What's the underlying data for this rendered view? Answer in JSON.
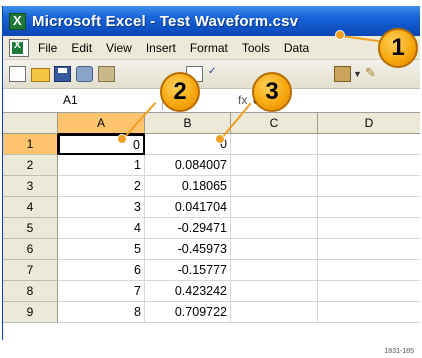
{
  "window": {
    "title": "Microsoft Excel - Test Waveform.csv"
  },
  "menu": {
    "items": [
      "File",
      "Edit",
      "View",
      "Insert",
      "Format",
      "Tools",
      "Data"
    ]
  },
  "formula_bar": {
    "name_box": "A1",
    "fx": "fx",
    "value": "0"
  },
  "sheet": {
    "columns": [
      "A",
      "B",
      "C",
      "D"
    ],
    "rows": [
      {
        "num": "1",
        "a": "0",
        "b": "0"
      },
      {
        "num": "2",
        "a": "1",
        "b": "0.084007"
      },
      {
        "num": "3",
        "a": "2",
        "b": "0.18065"
      },
      {
        "num": "4",
        "a": "3",
        "b": "0.041704"
      },
      {
        "num": "5",
        "a": "4",
        "b": "-0.29471"
      },
      {
        "num": "6",
        "a": "5",
        "b": "-0.45973"
      },
      {
        "num": "7",
        "a": "6",
        "b": "-0.15777"
      },
      {
        "num": "8",
        "a": "7",
        "b": "0.423242"
      },
      {
        "num": "9",
        "a": "8",
        "b": "0.709722"
      }
    ]
  },
  "callouts": {
    "one": "1",
    "two": "2",
    "three": "3"
  },
  "figure_code": "1831-185",
  "colors": {
    "title_bar": "#0f54c6",
    "selection": "#ffc56e",
    "callout": "#f7a80f"
  }
}
